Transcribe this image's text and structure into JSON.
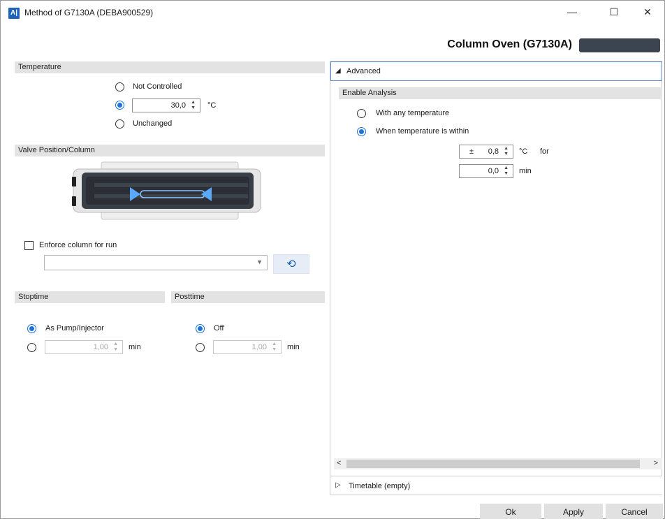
{
  "window": {
    "title": "Method of G7130A (DEBA900529)",
    "app_icon_text": "A|",
    "minimize": "—",
    "maximize": "☐",
    "close": "✕"
  },
  "header": {
    "device_title": "Column Oven (G7130A)"
  },
  "temperature": {
    "section_label": "Temperature",
    "not_controlled_label": "Not Controlled",
    "value": "30,0",
    "unit": "°C",
    "unchanged_label": "Unchanged",
    "selected": "value"
  },
  "valve": {
    "section_label": "Valve Position/Column",
    "enforce_label": "Enforce column for run",
    "column_value": ""
  },
  "stoptime": {
    "section_label": "Stoptime",
    "as_pump_label": "As Pump/Injector",
    "value": "1,00",
    "unit": "min"
  },
  "posttime": {
    "section_label": "Posttime",
    "off_label": "Off",
    "value": "1,00",
    "unit": "min"
  },
  "advanced": {
    "header_label": "Advanced",
    "enable_analysis_label": "Enable Analysis",
    "any_temp_label": "With any temperature",
    "within_label": "When temperature is within",
    "plusminus": "±",
    "tolerance_value": "0,8",
    "tolerance_unit": "°C",
    "for_label": "for",
    "time_value": "0,0",
    "time_unit": "min"
  },
  "timetable": {
    "label": "Timetable (empty)"
  },
  "footer": {
    "ok": "Ok",
    "apply": "Apply",
    "cancel": "Cancel"
  },
  "colors": {
    "accent": "#1a73d8",
    "section_bg": "#e3e3e3",
    "column_body": "#3a3f47"
  }
}
